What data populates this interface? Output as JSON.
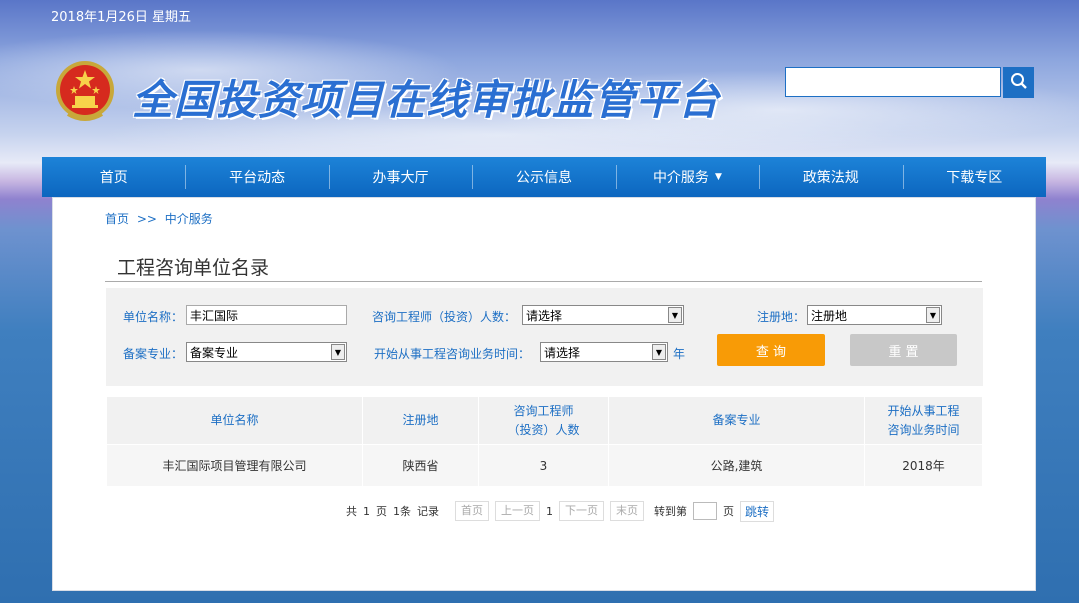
{
  "header": {
    "date": "2018年1月26日 星期五",
    "site_title": "全国投资项目在线审批监管平台",
    "search": {
      "value": "",
      "placeholder": ""
    }
  },
  "nav": {
    "items": [
      {
        "label": "首页"
      },
      {
        "label": "平台动态"
      },
      {
        "label": "办事大厅"
      },
      {
        "label": "公示信息"
      },
      {
        "label": "中介服务",
        "caret": "▼"
      },
      {
        "label": "政策法规"
      },
      {
        "label": "下载专区"
      }
    ]
  },
  "breadcrumb": {
    "home": "首页",
    "sep": ">>",
    "current": "中介服务"
  },
  "page_title": "工程咨询单位名录",
  "filter": {
    "unit_name_label": "单位名称：",
    "unit_name_value": "丰汇国际",
    "engineer_count_label": "咨询工程师（投资）人数：",
    "engineer_count_value": "请选择",
    "region_label": "注册地：",
    "region_value": "注册地",
    "specialty_label": "备案专业：",
    "specialty_value": "备案专业",
    "start_time_label": "开始从事工程咨询业务时间：",
    "start_time_value": "请选择",
    "year_suffix": "年",
    "query_button": "查 询",
    "reset_button": "重 置"
  },
  "table": {
    "headers": [
      "单位名称",
      "注册地",
      "咨询工程师\n（投资）人数",
      "备案专业",
      "开始从事工程\n咨询业务时间"
    ],
    "header_lines": [
      [
        "单位名称"
      ],
      [
        "注册地"
      ],
      [
        "咨询工程师",
        "（投资）人数"
      ],
      [
        "备案专业"
      ],
      [
        "开始从事工程",
        "咨询业务时间"
      ]
    ],
    "rows": [
      [
        "丰汇国际项目管理有限公司",
        "陕西省",
        "3",
        "公路,建筑",
        "2018年"
      ]
    ]
  },
  "pager": {
    "total_prefix": "共",
    "total_pages": "1",
    "page_unit": "页",
    "records": "1条",
    "records_suffix": "记录",
    "first": "首页",
    "prev": "上一页",
    "current": "1",
    "next": "下一页",
    "last": "末页",
    "goto_prefix": "转到第",
    "goto_suffix": "页",
    "go": "跳转"
  },
  "colors": {
    "brand_blue": "#1d6fc4",
    "query_orange": "#f89b06",
    "reset_gray": "#c8c8c8"
  },
  "icons": {
    "search": "search-icon",
    "emblem": "national-emblem-icon",
    "select_arrow": "dropdown-arrow-icon"
  }
}
